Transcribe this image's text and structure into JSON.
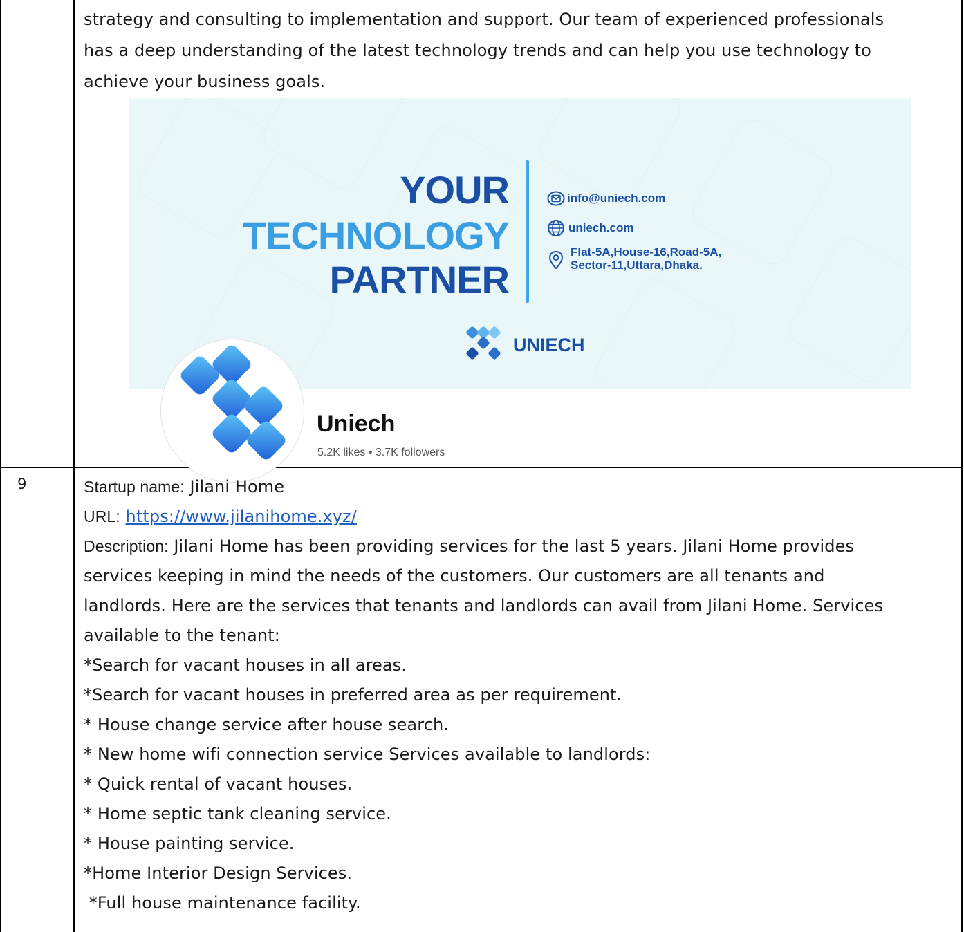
{
  "row8": {
    "text_lines": [
      "strategy and consulting to implementation and support. Our team of experienced professionals",
      "has a deep understanding of the latest technology trends and can help you use technology to",
      "achieve your business goals."
    ],
    "banner": {
      "headline": [
        "YOUR",
        "TECHNOLOGY",
        "PARTNER"
      ],
      "email": "info@uniech.com",
      "website": "uniech.com",
      "address_line1": "Flat-5A,House-16,Road-5A,",
      "address_line2": "Sector-11,Uttara,Dhaka.",
      "brand": "UNIECH",
      "icons": [
        "mail-icon",
        "globe-icon",
        "location-pin-icon"
      ]
    },
    "profile": {
      "name": "Uniech",
      "stats": "5.2K likes • 3.7K followers"
    }
  },
  "row9": {
    "number": "9",
    "startup_label": "Startup name:",
    "startup_name": " Jilani Home",
    "url_label": "URL:",
    "url": "https://www.jilanihome.xyz/",
    "description_label": "Description:",
    "description_lines": [
      " Jilani Home has been providing services for the last 5 years. Jilani Home provides",
      "services keeping in mind the needs of the customers. Our customers are all tenants and",
      "landlords. Here are the services that tenants and landlords can avail from Jilani Home. Services",
      "available to the tenant:"
    ],
    "services": [
      "*Search for vacant houses in all areas.",
      "*Search for vacant houses in preferred area as per requirement.",
      "* House change service after house search.",
      "* New home wifi connection service Services available to landlords:",
      "* Quick rental of vacant houses.",
      "* Home septic tank cleaning service.",
      "* House painting service.",
      "*Home Interior Design Services.",
      " *Full house maintenance facility."
    ]
  },
  "colors": {
    "headline_dark": "#1b4fa3",
    "headline_light": "#3a9ee0",
    "link": "#1f5fbf",
    "banner_bg": "#e9f7f9"
  }
}
